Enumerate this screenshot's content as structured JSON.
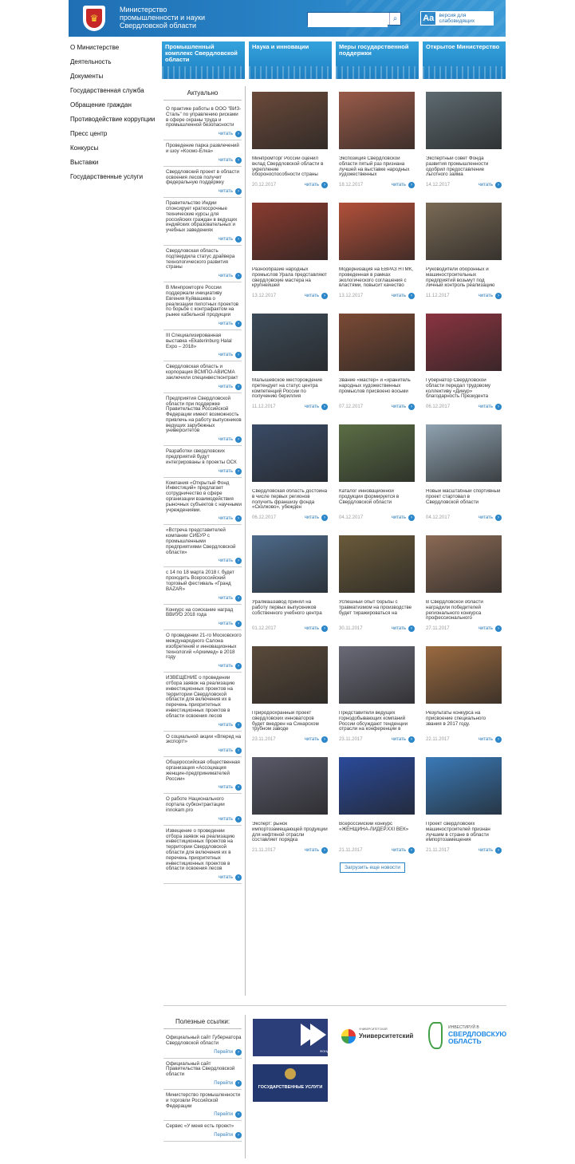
{
  "header": {
    "title": "Министерство промышленности и науки Свердловской области",
    "search_placeholder": "",
    "search_icon": "search-icon",
    "a11y_big": "Aa",
    "a11y_label": "версия для слабовидящих"
  },
  "nav": [
    "О Министерстве",
    "Деятельность",
    "Документы",
    "Государственная служба",
    "Обращение граждан",
    "Противодействие коррупции",
    "Пресс центр",
    "Конкурсы",
    "Выставки",
    "Государственные услуги"
  ],
  "banners": [
    "Промышленный комплекс Свердловской области",
    "Наука и инновации",
    "Меры государственной поддержки",
    "Открытое Министерство"
  ],
  "sidebar": {
    "title": "Актуально",
    "read": "читать",
    "items": [
      "О практике работы в ООО \"ВИЗ-Сталь\" по управлению рисками в сфере охраны труда и промышленной безопасности",
      "Проведение парка развлечений и шоу «Космо-Елка»",
      "Свердловский проект в области освоения лесов получит федеральную поддержку",
      "Правительство Индии спонсирует краткосрочные технические курсы для российских граждан в ведущих индийских образовательных и учебных заведениях",
      "Свердловская область подтвердила статус драйвера технологического развития страны",
      "В Минпромторге России поддержали инициативу Евгения Куйвашева о реализации пилотных проектов по борьбе с контрафактом на рынке кабельной продукции",
      "III Специализированная выставка «Ekaterinburg Halal Expo – 2018»",
      "Свердловская область и корпорация ВСМПО-АВИСМА заключили специнвестконтракт",
      "Предприятия Свердловской области при поддержке Правительства Российской Федерации имеют возможность привлечь на работу выпускников ведущих зарубежных университетов",
      "Разработки свердловских предприятий будут интегрированы в проекты ОСК",
      "Компания «Открытый Фонд Инвестиций» предлагает сотрудничество в сфере организации взаимодействия рыночных субъектов с научными учреждениями.",
      "«Встреча представителей компании СИБУР с промышленными предприятиями Свердловской области»",
      "с 14 по 18 марта 2018 г. будет проходить Всероссийский торговый фестиваль «Гранд BAZAR»",
      "Конкурс на соискание наград ВВИУО 2018 года",
      "О проведении 21-го Московского международного Салона изобретений и инновационных технологий «Архимед» в 2018 году",
      "ИЗВЕЩЕНИЕ о проведении отбора заявок на реализацию инвестиционных проектов на территории Свердловской области для включения их в перечень приоритетных инвестиционных проектов в области освоения лесов",
      "О социальной акции «Вперед на экспорт!»",
      "Общероссийская общественная организация «Ассоциация женщин-предпринимателей России»",
      "О работе Национального портала субконтрактации innokam.pro",
      "Извещение о проведении отбора заявок на реализацию инвестиционных проектов на территории Свердловской области для включения их в перечень приоритетных инвестиционных проектов в области освоения лесов"
    ]
  },
  "news_read": "читать",
  "news": [
    {
      "caption": "Минпромторг России оценил вклад Свердловской области в укрепление обороноспособности страны",
      "date": "20.12.2017",
      "color": "#6b4a3a"
    },
    {
      "caption": "Экспозиция Свердловской области пятый раз признана лучшей на выставке народных художественных",
      "date": "18.12.2017",
      "color": "#9a5b49"
    },
    {
      "caption": "Экспертный совет Фонда развития промышленности одобрил предоставление льготного займа",
      "date": "14.12.2017",
      "color": "#5d6a70"
    },
    {
      "caption": "Разнообразие народных промыслов Урала представляют свердловские мастера на крупнейшей",
      "date": "13.12.2017",
      "color": "#8a3b2f"
    },
    {
      "caption": "Модернизация на ЕВРАЗ НТМК, проведенная в рамках экологического соглашения с властями, повысит качество",
      "date": "13.12.2017",
      "color": "#b2503a"
    },
    {
      "caption": "Руководители оборонных и машиностроительных предприятий возьмут под личный контроль реализацию",
      "date": "11.12.2017",
      "color": "#7a6a55"
    },
    {
      "caption": "Малышевское месторождение претендует на статус центра компетенций России по получению бериллия",
      "date": "11.12.2017",
      "color": "#3d4b58"
    },
    {
      "caption": "Звание «мастер» и «хранитель народных художественных промыслов присвоено восьми",
      "date": "07.12.2017",
      "color": "#7b4a35"
    },
    {
      "caption": "Губернатор Свердловской области передал трудовому коллективу «Динур» благодарность Президента",
      "date": "06.12.2017",
      "color": "#8a3440"
    },
    {
      "caption": "Свердловская область достойна в числе первых регионов получить франшизу фонда «Сколково», убежден",
      "date": "06.12.2017",
      "color": "#3a4b66"
    },
    {
      "caption": "Каталог инновационной продукции формируется в Свердловской области",
      "date": "04.12.2017",
      "color": "#5b6e45"
    },
    {
      "caption": "Новый масштабный спортивный проект стартовал в Свердловской области",
      "date": "04.12.2017",
      "color": "#8fa2b0"
    },
    {
      "caption": "Уралмашзавод принял на работу первых выпускников собственного учебного центра",
      "date": "01.12.2017",
      "color": "#4d6a8a"
    },
    {
      "caption": "Успешный опыт борьбы с травматизмом на производстве будет тиражироваться на",
      "date": "30.11.2017",
      "color": "#6a5a3a"
    },
    {
      "caption": "В Свердловской области наградили победителей регионального конкурса профессионального",
      "date": "27.11.2017",
      "color": "#8a6a55"
    },
    {
      "caption": "Природоохранный проект свердловских инноваторов будет внедрен на Синарском трубном заводе",
      "date": "23.11.2017",
      "color": "#5a4a3a"
    },
    {
      "caption": "Представители ведущих горнодобывающих компаний России обсуждают тенденции отрасли на конференции в",
      "date": "23.11.2017",
      "color": "#6a6a78"
    },
    {
      "caption": "Результаты конкурса на присвоение специального звания в 2017 году.",
      "date": "22.11.2017",
      "color": "#9a6a40"
    },
    {
      "caption": "Эксперт: рынок импортозамещающей продукции для нефтяной отрасли составляет порядка",
      "date": "21.11.2017",
      "color": "#5a5a6a"
    },
    {
      "caption": "Всероссийский конкурс «ЖЕНЩИНА-ЛИДЕР.XXI ВЕК»",
      "date": "21.11.2017",
      "color": "#2a4a9a"
    },
    {
      "caption": "Проект свердловских машиностроителей признан лучшим в стране в области импортозамещения",
      "date": "21.11.2017",
      "color": "#3a7ab8"
    }
  ],
  "load_more": "Загрузить еще новости",
  "useful": {
    "title": "Полезные ссылки:",
    "go": "Перейти",
    "items": [
      "Официальный сайт Губернатора Свердловской области",
      "Официальный сайт Правительства Свердловской области",
      "Министерство промышленности и торговли Российской Федерации",
      "Сервис «У меня есть проект»"
    ]
  },
  "partners": {
    "fund": "ФОНД",
    "university_small": "УНИВЕРСИТЕТСКИЙ",
    "university": "Университетский",
    "invest_small": "ИНВЕСТИРУЙ В",
    "invest": "СВЕРДЛОВСКУЮ ОБЛАСТЬ",
    "gosuslugi": "ГОСУДАРСТВЕННЫЕ УСЛУГИ"
  }
}
